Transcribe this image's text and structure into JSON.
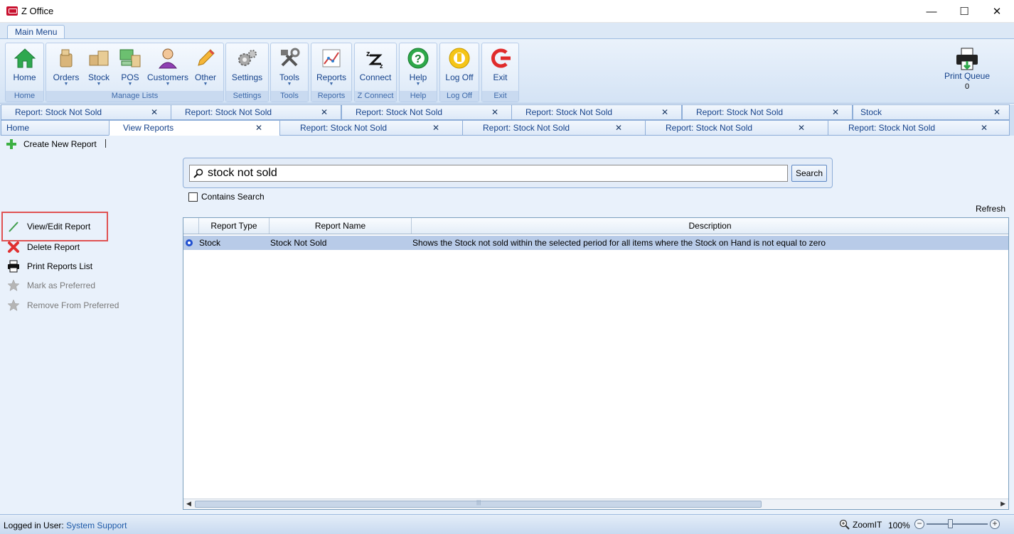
{
  "window": {
    "title": "Z Office",
    "min_glyph": "—",
    "max_glyph": "☐",
    "close_glyph": "✕"
  },
  "ribbon": {
    "tab_label": "Main Menu",
    "groups": [
      {
        "label": "Home"
      },
      {
        "label": "Manage Lists"
      },
      {
        "label": "Settings"
      },
      {
        "label": "Tools"
      },
      {
        "label": "Reports"
      },
      {
        "label": "Z Connect"
      },
      {
        "label": "Help"
      },
      {
        "label": "Log Off"
      },
      {
        "label": "Exit"
      }
    ],
    "buttons": {
      "home": "Home",
      "orders": "Orders",
      "stock": "Stock",
      "pos": "POS",
      "customers": "Customers",
      "other": "Other",
      "settings": "Settings",
      "tools": "Tools",
      "reports": "Reports",
      "connect": "Connect",
      "help": "Help",
      "logoff": "Log Off",
      "exit": "Exit"
    },
    "print_queue": {
      "label": "Print Queue",
      "count": "0"
    }
  },
  "tabs_row1": [
    "Report: Stock Not Sold",
    "Report: Stock Not Sold",
    "Report: Stock Not Sold",
    "Report: Stock Not Sold",
    "Report: Stock Not Sold",
    "Stock"
  ],
  "tabs_row2": [
    "Home",
    "View Reports",
    "Report: Stock Not Sold",
    "Report: Stock Not Sold",
    "Report: Stock Not Sold",
    "Report: Stock Not Sold"
  ],
  "tab_close_glyph": "✕",
  "toolbar": {
    "create_label": "Create New Report"
  },
  "side_actions": {
    "view_edit": "View/Edit Report",
    "delete": "Delete Report",
    "print_list": "Print Reports List",
    "mark_preferred": "Mark as Preferred",
    "remove_preferred": "Remove From Preferred"
  },
  "search": {
    "value": "stock not sold",
    "button_label": "Search",
    "contains_label": "Contains Search",
    "contains_checked": false
  },
  "refresh_label": "Refresh",
  "grid": {
    "columns": [
      "Report Type",
      "Report Name",
      "Description"
    ],
    "rows": [
      {
        "type": "Stock",
        "name": "Stock Not Sold",
        "description": "Shows the Stock not sold within the selected period for all items where the Stock on Hand is not equal to zero"
      }
    ],
    "scroll_grip": "|||"
  },
  "status": {
    "label": "Logged in User:",
    "user": "System Support",
    "zoom_label": "ZoomIT",
    "zoom_pct": "100%"
  },
  "colors": {
    "accent": "#15428b",
    "selection": "#b8cbe8",
    "highlight_border": "#e05252"
  }
}
